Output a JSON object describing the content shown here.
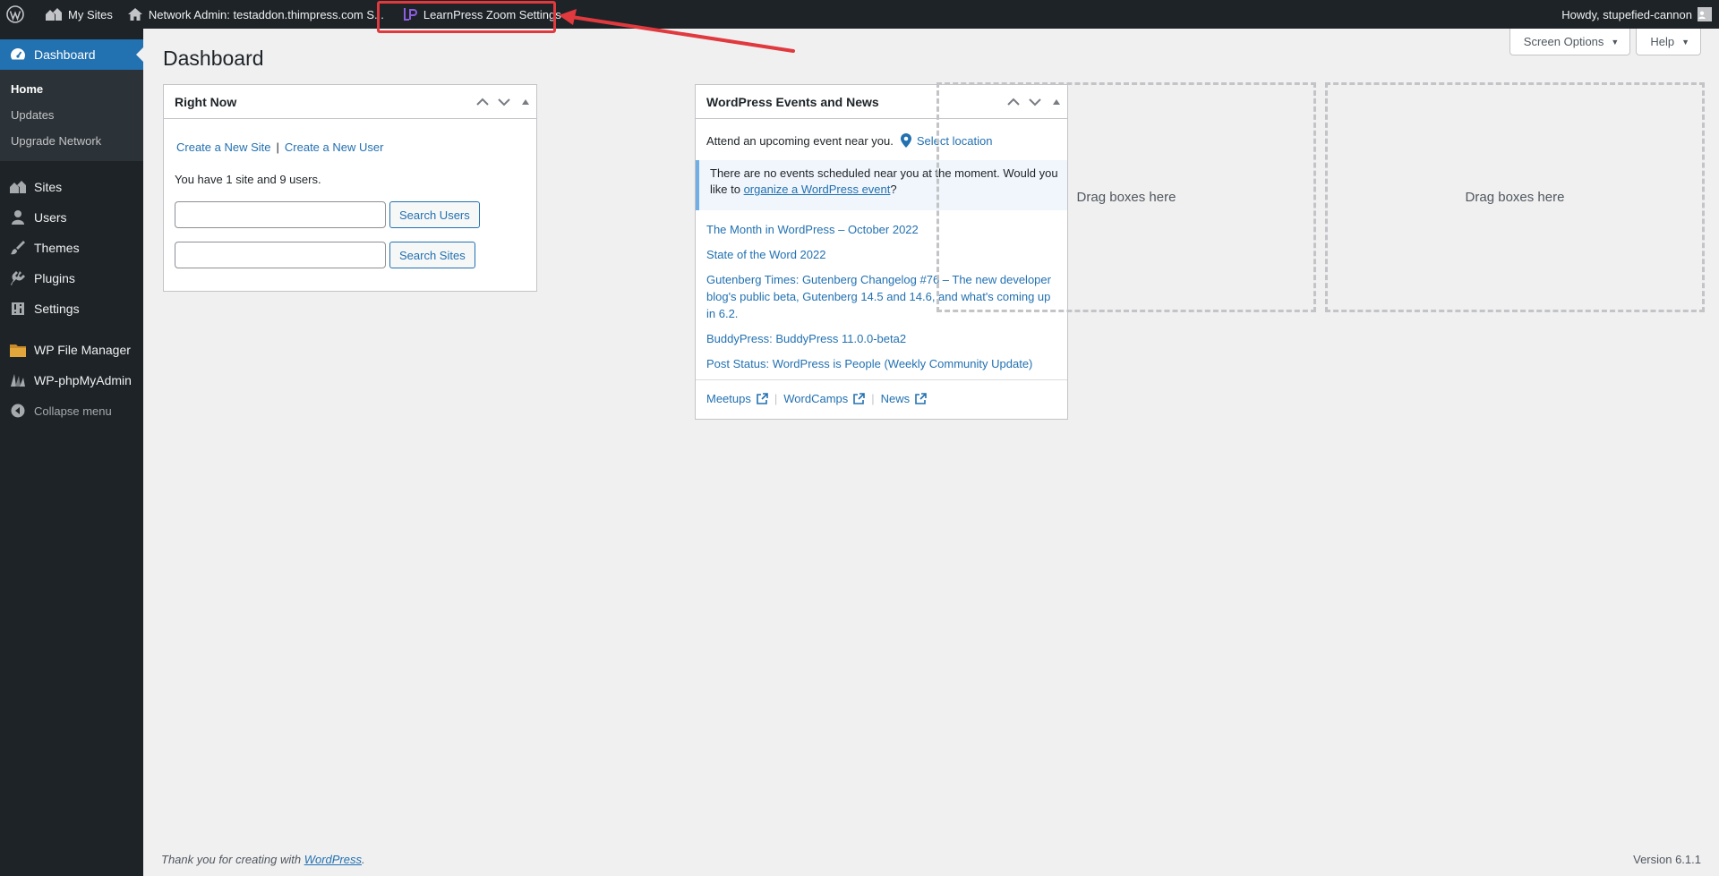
{
  "adminbar": {
    "my_sites": "My Sites",
    "network_admin": "Network Admin: testaddon.thimpress.com S...",
    "learnpress_zoom": "LearnPress Zoom Settings",
    "howdy": "Howdy, stupefied-cannon"
  },
  "sidebar": {
    "dashboard": "Dashboard",
    "submenu": [
      "Home",
      "Updates",
      "Upgrade Network"
    ],
    "items": [
      {
        "label": "Sites",
        "icon": "sites-icon"
      },
      {
        "label": "Users",
        "icon": "users-icon"
      },
      {
        "label": "Themes",
        "icon": "themes-icon"
      },
      {
        "label": "Plugins",
        "icon": "plugins-icon"
      },
      {
        "label": "Settings",
        "icon": "settings-icon"
      }
    ],
    "file_manager": "WP File Manager",
    "phpmyadmin": "WP-phpMyAdmin",
    "collapse": "Collapse menu"
  },
  "screen_options": "Screen Options",
  "help": "Help",
  "page_title": "Dashboard",
  "right_now": {
    "title": "Right Now",
    "create_site": "Create a New Site",
    "separator": "|",
    "create_user": "Create a New User",
    "summary": "You have 1 site and 9 users.",
    "search_users": "Search Users",
    "search_sites": "Search Sites"
  },
  "events": {
    "title": "WordPress Events and News",
    "attend": "Attend an upcoming event near you.",
    "select_location": "Select location",
    "notice_prefix": "There are no events scheduled near you at the moment. Would you like to ",
    "notice_link": "organize a WordPress event",
    "notice_suffix": "?",
    "news": [
      "The Month in WordPress – October 2022",
      "State of the Word 2022",
      "Gutenberg Times: Gutenberg Changelog #76 – The new developer blog's public beta, Gutenberg 14.5 and 14.6, and what's coming up in 6.2.",
      "BuddyPress: BuddyPress 11.0.0-beta2",
      "Post Status: WordPress is People (Weekly Community Update)"
    ],
    "footer": {
      "meetups": "Meetups",
      "wordcamps": "WordCamps",
      "news": "News",
      "separator": "|"
    }
  },
  "drag_boxes": "Drag boxes here",
  "footer": {
    "thanks": "Thank you for creating with ",
    "wordpress": "WordPress",
    "period": "."
  },
  "version": "Version 6.1.1",
  "colors": {
    "accent": "#2271b1",
    "adminbar": "#1d2327",
    "highlight": "#e0393e"
  }
}
